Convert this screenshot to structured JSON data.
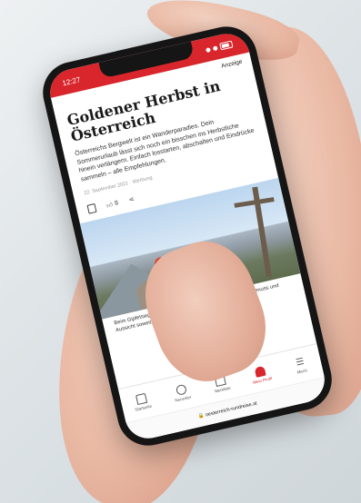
{
  "status_bar": {
    "time": "12:27"
  },
  "top_bar": {
    "link": "Anzeige"
  },
  "article": {
    "headline": "Goldener Herbst in Österreich",
    "teaser": "Österreichs Bergwelt ist ein Wanderparadies. Dein Sommerurlaub lässt sich noch ein bisschen ins Herbstliche hinein verlängern. Einfach losstarten, abschalten und Eindrücke sammeln – alle Empfehlungen.",
    "meta": "22. September 2021 · Werbung",
    "likes": "8",
    "caption": "Beim Gipfelsieg auf einem der vielen Dreitausender in Tirol: Genuss und Aussicht soweit das Auge reicht – willkommen im Herbst."
  },
  "bottom_nav": [
    {
      "label": "Startseite",
      "icon": "home-icon"
    },
    {
      "label": "Neuester",
      "icon": "clock-icon"
    },
    {
      "label": "Merkliste",
      "icon": "bookmark-icon"
    },
    {
      "label": "Mein Profil",
      "icon": "person-icon"
    },
    {
      "label": "Menü",
      "icon": "menu-icon"
    }
  ],
  "url_bar": {
    "text": "🔒 oesterreich-rundreise.at"
  },
  "colors": {
    "brand_red": "#d8262c"
  }
}
